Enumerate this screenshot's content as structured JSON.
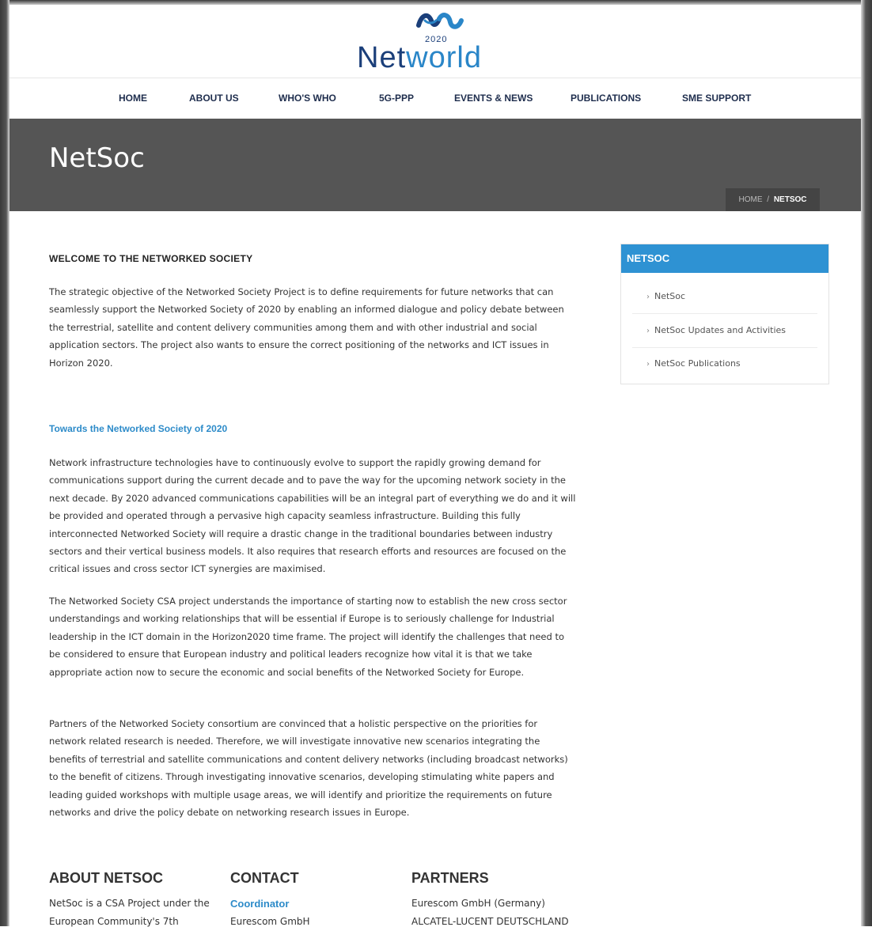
{
  "header": {
    "logo_year": "2020",
    "logo_word_a": "Net",
    "logo_word_b": "world",
    "brand_colors": {
      "navy": "#1b3f7a",
      "blue": "#2a86c8"
    }
  },
  "nav": [
    "HOME",
    "ABOUT US",
    "WHO'S WHO",
    "5G-PPP",
    "EVENTS & NEWS",
    "PUBLICATIONS",
    "SME SUPPORT"
  ],
  "banner": {
    "title": "NetSoc",
    "breadcrumb": {
      "home": "HOME",
      "sep": "/",
      "current": "NETSOC"
    },
    "bg": "#555555"
  },
  "main": {
    "welcome_heading": "WELCOME TO THE NETWORKED SOCIETY",
    "intro": "The strategic objective of the Networked Society Project is to define requirements for future networks that can seamlessly support the Networked Society of 2020 by enabling an informed dialogue and policy debate between the terrestrial, satellite and content delivery communities among them and with other industrial and social application sectors. The project also wants to ensure the correct positioning of the networks and ICT issues in Horizon 2020.",
    "towards_heading": "Towards the Networked Society of 2020",
    "para1": "Network infrastructure technologies have to continuously evolve to support the rapidly growing demand for communications support during the current decade and to pave the way for the upcoming network society in the next decade. By 2020 advanced communications capabilities will be an integral part of everything we do and it will be provided and operated through a pervasive high capacity seamless infrastructure. Building this fully interconnected Networked Society will require a drastic change in the traditional boundaries between industry sectors and their vertical business models. It also requires that research efforts and resources are focused on the critical issues and cross sector ICT synergies are maximised.",
    "para2": "The Networked Society CSA project understands the importance of starting now to establish the new cross sector understandings and working relationships that will be essential if Europe is to seriously challenge for Industrial leadership in the ICT domain in the Horizon2020 time frame. The project will identify the challenges that need to be considered to ensure that European industry and political leaders recognize how vital it is that we take appropriate action now to secure the economic and social benefits of the Networked Society for Europe.",
    "para3": "Partners of the Networked Society consortium are convinced that a holistic perspective on the priorities for network related research is needed. Therefore, we will investigate innovative new scenarios integrating the benefits of terrestrial and satellite communications and content delivery networks (including broadcast networks) to the benefit of citizens. Through investigating innovative scenarios, developing stimulating white papers and leading guided workshops with multiple usage areas, we will identify and prioritize the requirements on future networks and drive the policy debate on networking research issues in Europe.",
    "heading_color": "#2d8bc9"
  },
  "sidebar": {
    "title": "NETSOC",
    "items": [
      "NetSoc",
      "NetSoc Updates and Activities",
      "NetSoc Publications"
    ],
    "accent": "#2e92d3"
  },
  "footer": {
    "about": {
      "heading": "ABOUT NETSOC",
      "line1": "NetSoc is a CSA Project under the",
      "line2": "European Community's 7th"
    },
    "contact": {
      "heading": "CONTACT",
      "coordinator": "Coordinator",
      "line2": "Eurescom GmbH"
    },
    "partners": {
      "heading": "PARTNERS",
      "line1": "Eurescom GmbH (Germany)",
      "line2": "ALCATEL-LUCENT DEUTSCHLAND"
    }
  }
}
